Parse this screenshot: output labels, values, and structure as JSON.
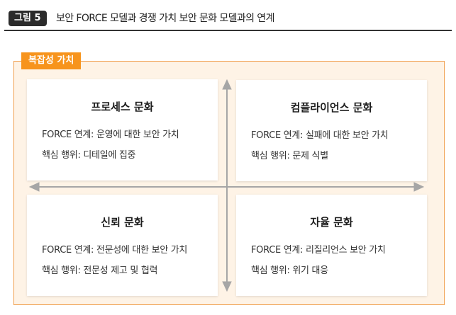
{
  "figure": {
    "badge": "그림 5",
    "title": "보안 FORCE 모델과 경쟁 가치 보안 문화 모델과의 연계"
  },
  "panel": {
    "tag": "복잡성 가치"
  },
  "quadrants": {
    "top_left": {
      "title": "프로세스 문화",
      "line1": "FORCE 연계: 운영에 대한 보안 가치",
      "line2": "핵심 행위: 디테일에 집중"
    },
    "top_right": {
      "title": "컴플라이언스 문화",
      "line1": "FORCE 연계: 실패에 대한 보안 가치",
      "line2": "핵심 행위: 문제 식별"
    },
    "bottom_left": {
      "title": "신뢰 문화",
      "line1": "FORCE 연계: 전문성에 대한 보안 가치",
      "line2": "핵심 행위: 전문성 제고 및 협력"
    },
    "bottom_right": {
      "title": "자율 문화",
      "line1": "FORCE 연계: 리질리언스 보안 가치",
      "line2": "핵심 행위: 위기 대응"
    }
  },
  "colors": {
    "accent": "#f7941d",
    "panel_border": "#f0a050",
    "panel_fill": "#fef3e6",
    "arrow": "#a6a6a6",
    "badge": "#2b2b2b"
  }
}
